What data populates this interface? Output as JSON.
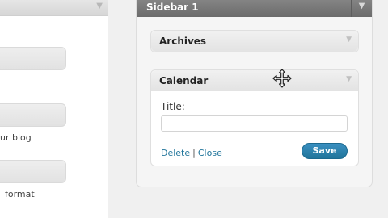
{
  "left_panel": {
    "descriptions": [
      "ur blog",
      "format"
    ]
  },
  "sidebar": {
    "title": "Sidebar 1",
    "widgets": [
      {
        "title": "Archives",
        "state": "collapsed"
      },
      {
        "title": "Calendar",
        "state": "expanded",
        "fields": {
          "title_label": "Title:",
          "title_value": ""
        },
        "actions": {
          "delete": "Delete",
          "separator": "|",
          "close": "Close"
        },
        "save_label": "Save"
      }
    ]
  },
  "colors": {
    "sidebar_header": "#7a7a7a",
    "link": "#21759b",
    "save_button": "#21759b"
  },
  "icons": [
    "chevron-down-icon",
    "move-cursor-icon"
  ]
}
